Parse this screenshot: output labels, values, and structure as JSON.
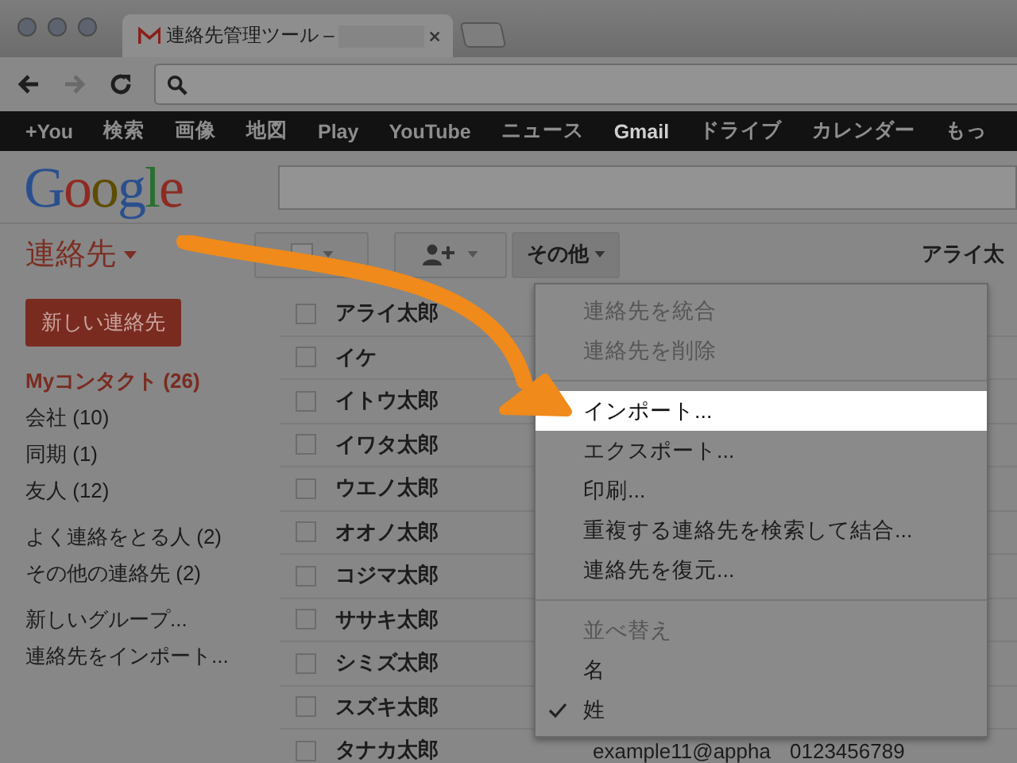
{
  "browser": {
    "tab_title": "連絡先管理ツール –",
    "google_bar": [
      {
        "label": "+You",
        "selected": false
      },
      {
        "label": "検索",
        "selected": false
      },
      {
        "label": "画像",
        "selected": false
      },
      {
        "label": "地図",
        "selected": false
      },
      {
        "label": "Play",
        "selected": false
      },
      {
        "label": "YouTube",
        "selected": false
      },
      {
        "label": "ニュース",
        "selected": false
      },
      {
        "label": "Gmail",
        "selected": true
      },
      {
        "label": "ドライブ",
        "selected": false
      },
      {
        "label": "カレンダー",
        "selected": false
      },
      {
        "label": "もっ",
        "selected": false
      }
    ]
  },
  "header": {
    "logo": "Google"
  },
  "app": {
    "title": "連絡先",
    "more_button": "その他",
    "current_contact": "アライ太"
  },
  "sidebar": {
    "new_button": "新しい連絡先",
    "sections": [
      {
        "items": [
          {
            "label": "Myコンタクト (26)",
            "selected": true
          },
          {
            "label": "会社 (10)",
            "selected": false
          },
          {
            "label": "同期 (1)",
            "selected": false
          },
          {
            "label": "友人 (12)",
            "selected": false
          }
        ]
      },
      {
        "items": [
          {
            "label": "よく連絡をとる人 (2)",
            "selected": false
          },
          {
            "label": "その他の連絡先 (2)",
            "selected": false
          }
        ]
      },
      {
        "items": [
          {
            "label": "新しいグループ...",
            "selected": false
          },
          {
            "label": "連絡先をインポート...",
            "selected": false
          }
        ]
      }
    ]
  },
  "contacts": [
    {
      "name": "アライ太郎",
      "checked": false
    },
    {
      "name": "イケ",
      "checked": false
    },
    {
      "name": "イトウ太郎",
      "checked": false
    },
    {
      "name": "イワタ太郎",
      "checked": false
    },
    {
      "name": "ウエノ太郎",
      "checked": false
    },
    {
      "name": "オオノ太郎",
      "checked": false
    },
    {
      "name": "コジマ太郎",
      "checked": false
    },
    {
      "name": "ササキ太郎",
      "checked": false
    },
    {
      "name": "シミズ太郎",
      "checked": false
    },
    {
      "name": "スズキ太郎",
      "checked": false
    },
    {
      "name": "タナカ太郎",
      "checked": false,
      "email": "example11@appha",
      "phone": "0123456789"
    }
  ],
  "menu": [
    {
      "kind": "item",
      "label": "連絡先を統合",
      "disabled": true,
      "selected": false,
      "checked": false
    },
    {
      "kind": "item",
      "label": "連絡先を削除",
      "disabled": true,
      "selected": false,
      "checked": false
    },
    {
      "kind": "divider"
    },
    {
      "kind": "item",
      "label": "インポート...",
      "disabled": false,
      "selected": true,
      "checked": false
    },
    {
      "kind": "item",
      "label": "エクスポート...",
      "disabled": false,
      "selected": false,
      "checked": false
    },
    {
      "kind": "item",
      "label": "印刷...",
      "disabled": false,
      "selected": false,
      "checked": false
    },
    {
      "kind": "item",
      "label": "重複する連絡先を検索して結合...",
      "disabled": false,
      "selected": false,
      "checked": false
    },
    {
      "kind": "item",
      "label": "連絡先を復元...",
      "disabled": false,
      "selected": false,
      "checked": false
    },
    {
      "kind": "divider"
    },
    {
      "kind": "heading",
      "label": "並べ替え"
    },
    {
      "kind": "item",
      "label": "名",
      "disabled": false,
      "selected": false,
      "checked": false
    },
    {
      "kind": "item",
      "label": "姓",
      "disabled": false,
      "selected": false,
      "checked": true
    }
  ]
}
